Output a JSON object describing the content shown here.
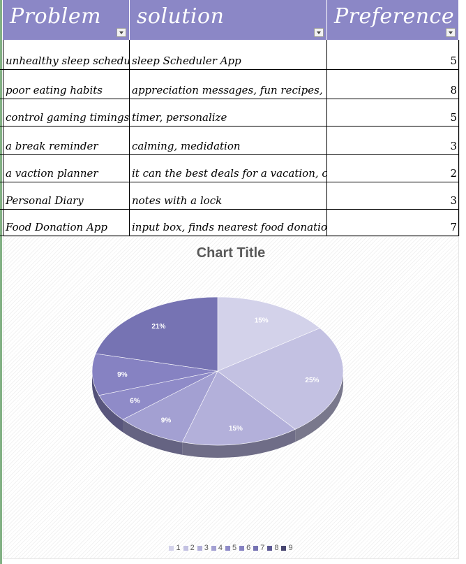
{
  "table": {
    "headers": [
      "Problem",
      "solution",
      "Preference"
    ],
    "rows": [
      {
        "problem": "unhealthy sleep schedule",
        "solution": "sleep Scheduler  App",
        "preference": "5"
      },
      {
        "problem": "poor eating habits",
        "solution": "appreciation messages, fun recipes,",
        "preference": "8"
      },
      {
        "problem": "control gaming timings",
        "solution": "timer, personalize",
        "preference": "5"
      },
      {
        "problem": "a break reminder",
        "solution": "calming, medidation",
        "preference": "3"
      },
      {
        "problem": "a vaction planner",
        "solution": "it can the best deals for a vacation, closest",
        "preference": "2"
      },
      {
        "problem": "Personal Diary",
        "solution": "notes with a lock",
        "preference": "3"
      },
      {
        "problem": "Food Donation App",
        "solution": "input box, finds nearest food donation area",
        "preference": "7"
      }
    ]
  },
  "chart_data": {
    "type": "pie",
    "title": "Chart Title",
    "style": "3d",
    "legend_position": "bottom",
    "categories": [
      "1",
      "2",
      "3",
      "4",
      "5",
      "6",
      "7",
      "8",
      "9"
    ],
    "values": [
      5,
      8,
      5,
      3,
      2,
      3,
      7,
      0,
      0
    ],
    "data_labels": [
      "15%",
      "25%",
      "15%",
      "9%",
      "6%",
      "9%",
      "21%",
      "",
      ""
    ],
    "colors": [
      "#d3d2ea",
      "#c3c1e2",
      "#b3b0da",
      "#a3a0d2",
      "#8f8bc8",
      "#8682c2",
      "#7673b3",
      "#5d5a94",
      "#47456f"
    ]
  }
}
